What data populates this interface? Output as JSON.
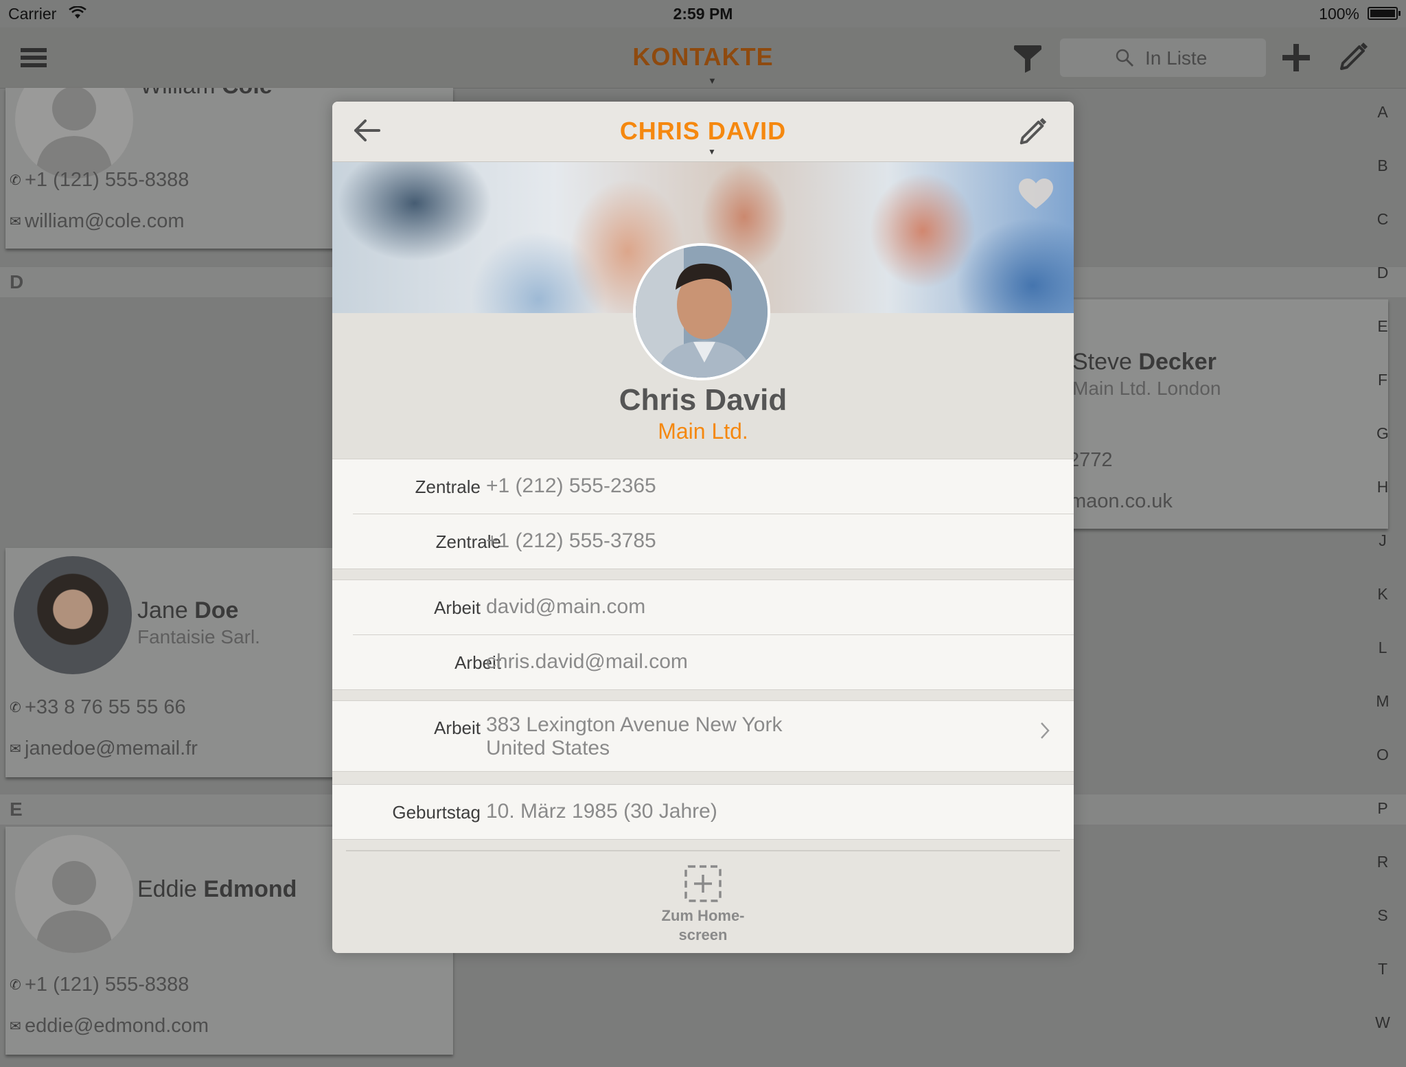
{
  "status_bar": {
    "carrier": "Carrier",
    "time": "2:59 PM",
    "battery": "100%"
  },
  "navbar": {
    "title": "KONTAKTE",
    "search_placeholder": "In Liste"
  },
  "sections": {
    "d": "D",
    "e": "E"
  },
  "contacts": [
    {
      "name_first": "William",
      "name_last": "Cole",
      "phone": "+1 (121) 555-8388",
      "email": "william@cole.com"
    },
    {
      "name_first": "Jane",
      "name_last": "Doe",
      "company": "Fantaisie Sarl.",
      "phone": "+33 8 76 55 55 66",
      "email": "janedoe@memail.fr"
    },
    {
      "name_first": "Eddie",
      "name_last": "Edmond",
      "phone": "+1 (121) 555-8388",
      "email": "eddie@edmond.com"
    },
    {
      "name_first": "Steve",
      "name_last": "Decker",
      "company": "Main Ltd. London",
      "phone": "2772",
      "email": "maon.co.uk"
    }
  ],
  "index_letters": [
    "A",
    "B",
    "C",
    "D",
    "E",
    "F",
    "G",
    "H",
    "J",
    "K",
    "L",
    "M",
    "O",
    "P",
    "R",
    "S",
    "T",
    "W"
  ],
  "detail": {
    "header_title": "CHRIS DAVID",
    "name": "Chris David",
    "company": "Main Ltd.",
    "phones": [
      {
        "label": "Zentrale",
        "value": "+1 (212) 555-2365"
      },
      {
        "label": "Zentrale",
        "value": "+1 (212) 555-3785"
      }
    ],
    "emails": [
      {
        "label": "Arbeit",
        "value": "david@main.com"
      },
      {
        "label": "Arbeit",
        "value": "chris.david@mail.com"
      }
    ],
    "address": {
      "label": "Arbeit",
      "line1": "383 Lexington Avenue New York",
      "line2": "United States"
    },
    "birthday": {
      "label": "Geburtstag",
      "value": "10. März 1985 (30 Jahre)"
    },
    "home_button": {
      "line1": "Zum Home-",
      "line2": "screen"
    }
  },
  "colors": {
    "accent": "#f5880f",
    "dim_title": "#8e4a0f"
  }
}
